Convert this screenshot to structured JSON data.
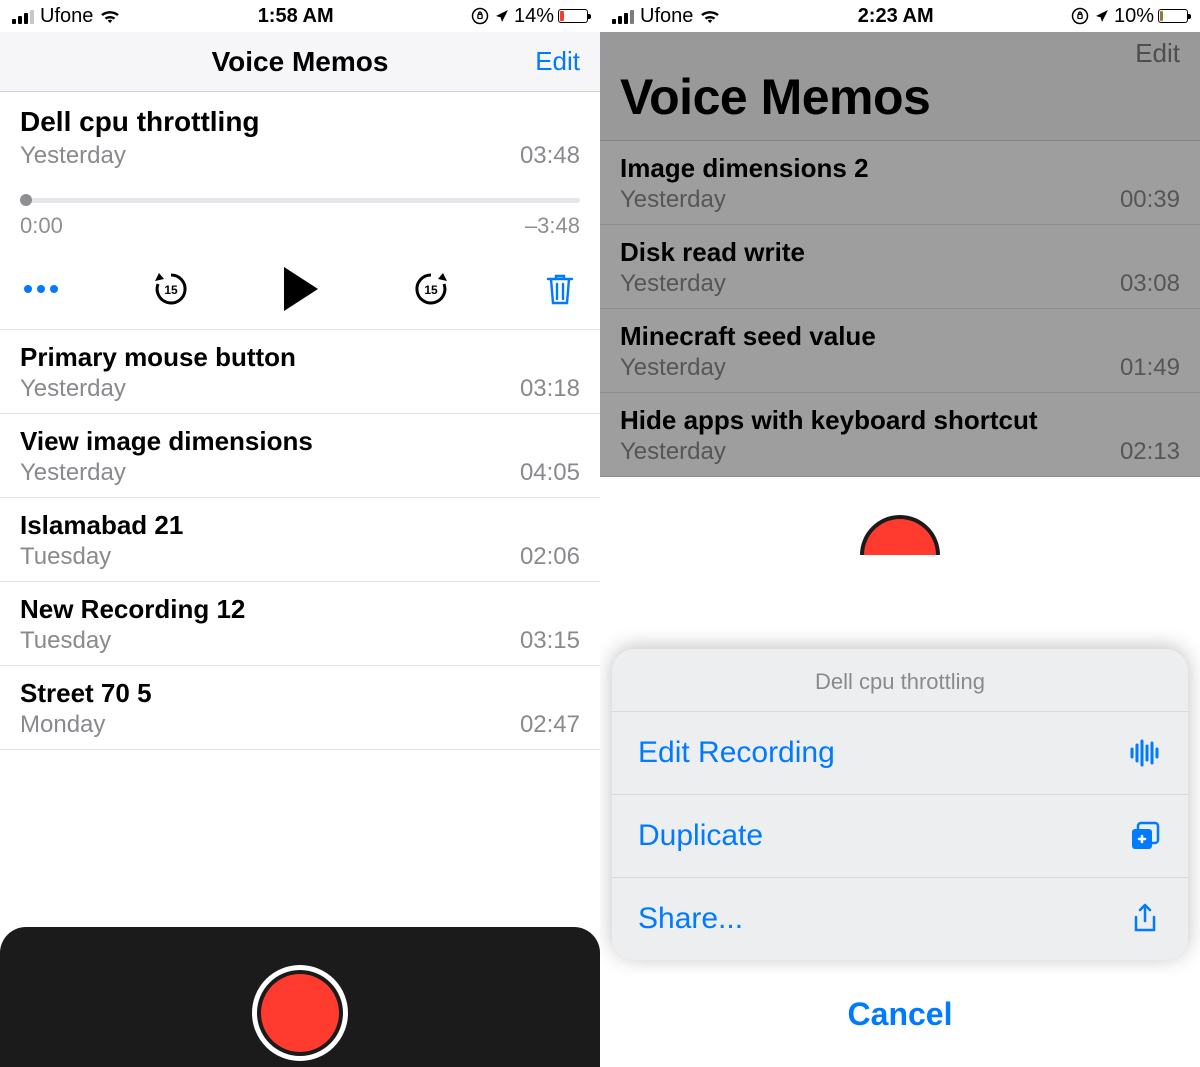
{
  "left": {
    "status": {
      "carrier": "Ufone",
      "time": "1:58 AM",
      "battery_pct": "14%"
    },
    "nav": {
      "title": "Voice Memos",
      "edit": "Edit"
    },
    "selected": {
      "title": "Dell cpu throttling",
      "date": "Yesterday",
      "duration": "03:48",
      "elapsed": "0:00",
      "remaining": "–3:48"
    },
    "memos": [
      {
        "title": "Primary mouse button",
        "date": "Yesterday",
        "duration": "03:18"
      },
      {
        "title": "View image dimensions",
        "date": "Yesterday",
        "duration": "04:05"
      },
      {
        "title": "Islamabad 21",
        "date": "Tuesday",
        "duration": "02:06"
      },
      {
        "title": "New Recording 12",
        "date": "Tuesday",
        "duration": "03:15"
      },
      {
        "title": "Street 70 5",
        "date": "Monday",
        "duration": "02:47"
      }
    ]
  },
  "right": {
    "status": {
      "carrier": "Ufone",
      "time": "2:23 AM",
      "battery_pct": "10%"
    },
    "nav": {
      "title": "Voice Memos",
      "edit": "Edit"
    },
    "memos": [
      {
        "title": "Image dimensions 2",
        "date": "Yesterday",
        "duration": "00:39"
      },
      {
        "title": "Disk read write",
        "date": "Yesterday",
        "duration": "03:08"
      },
      {
        "title": "Minecraft seed value",
        "date": "Yesterday",
        "duration": "01:49"
      },
      {
        "title": "Hide apps with keyboard shortcut",
        "date": "Yesterday",
        "duration": "02:13"
      }
    ],
    "sheet": {
      "title": "Dell cpu throttling",
      "actions": {
        "edit": "Edit Recording",
        "duplicate": "Duplicate",
        "share": "Share..."
      },
      "cancel": "Cancel"
    }
  },
  "colors": {
    "accent": "#007aff",
    "record": "#ff3b30"
  }
}
